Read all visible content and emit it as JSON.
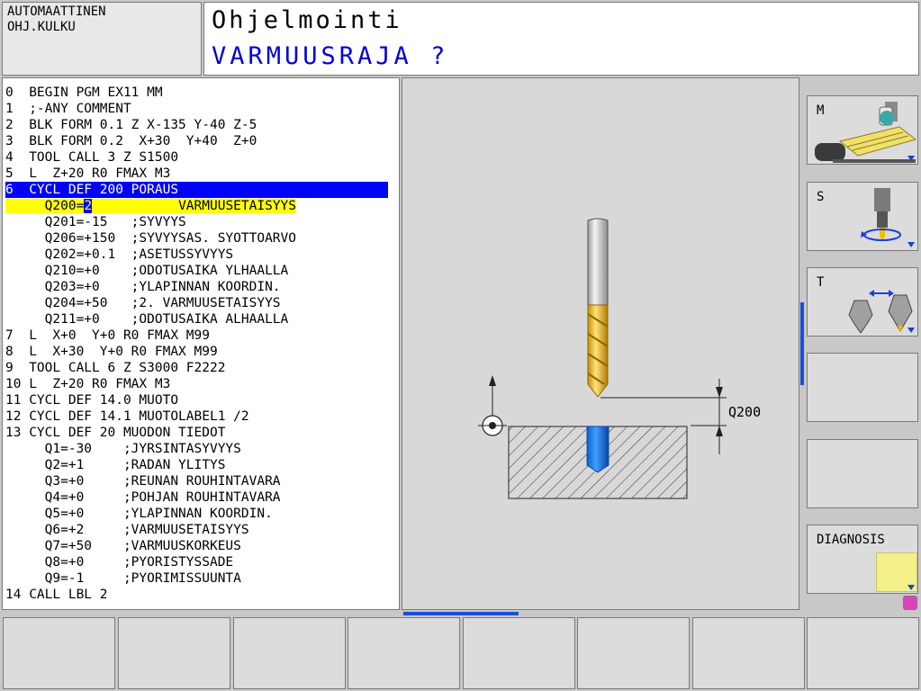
{
  "header": {
    "mode_line1": "AUTOMAATTINEN",
    "mode_line2": "OHJ.KULKU",
    "title": "Ohjelmointi",
    "prompt": "VARMUUSRAJA ?"
  },
  "program": {
    "lines": [
      "0  BEGIN PGM EX11 MM",
      "1  ;-ANY COMMENT",
      "2  BLK FORM 0.1 Z X-135 Y-40 Z-5",
      "3  BLK FORM 0.2  X+30  Y+40  Z+0",
      "4  TOOL CALL 3 Z S1500",
      "5  L  Z+20 R0 FMAX M3",
      "6  CYCL DEF 200 PORAUS",
      "",
      "     Q201=-15   ;SYVYYS",
      "     Q206=+150  ;SYVYYSAS. SYOTTOARVO",
      "     Q202=+0.1  ;ASETUSSYVYYS",
      "     Q210=+0    ;ODOTUSAIKA YLHAALLA",
      "     Q203=+0    ;YLAPINNAN KOORDIN.",
      "     Q204=+50   ;2. VARMUUSETAISYYS",
      "     Q211=+0    ;ODOTUSAIKA ALHAALLA",
      "7  L  X+0  Y+0 R0 FMAX M99",
      "8  L  X+30  Y+0 R0 FMAX M99",
      "9  TOOL CALL 6 Z S3000 F2222",
      "10 L  Z+20 R0 FMAX M3",
      "11 CYCL DEF 14.0 MUOTO",
      "12 CYCL DEF 14.1 MUOTOLABEL1 /2",
      "13 CYCL DEF 20 MUODON TIEDOT",
      "     Q1=-30    ;JYRSINTASYVYYS",
      "     Q2=+1     ;RADAN YLITYS",
      "     Q3=+0     ;REUNAN ROUHINTAVARA",
      "     Q4=+0     ;POHJAN ROUHINTAVARA",
      "     Q5=+0     ;YLAPINNAN KOORDIN.",
      "     Q6=+2     ;VARMUUSETAISYYS",
      "     Q7=+50    ;VARMUUSKORKEUS",
      "     Q8=+0     ;PYORISTYSSADE",
      "     Q9=-1     ;PYORIMISSUUNTA",
      "14 CALL LBL 2"
    ],
    "edit_line": {
      "prefix": "     Q200=",
      "value": "2",
      "comment": "           VARMUUSETAISYYS"
    },
    "selected_index": 6
  },
  "graphic": {
    "dimension_label": "Q200"
  },
  "softkeys_vertical": {
    "m_label": "M",
    "s_label": "S",
    "t_label": "T",
    "diagnosis_label": "DIAGNOSIS"
  }
}
